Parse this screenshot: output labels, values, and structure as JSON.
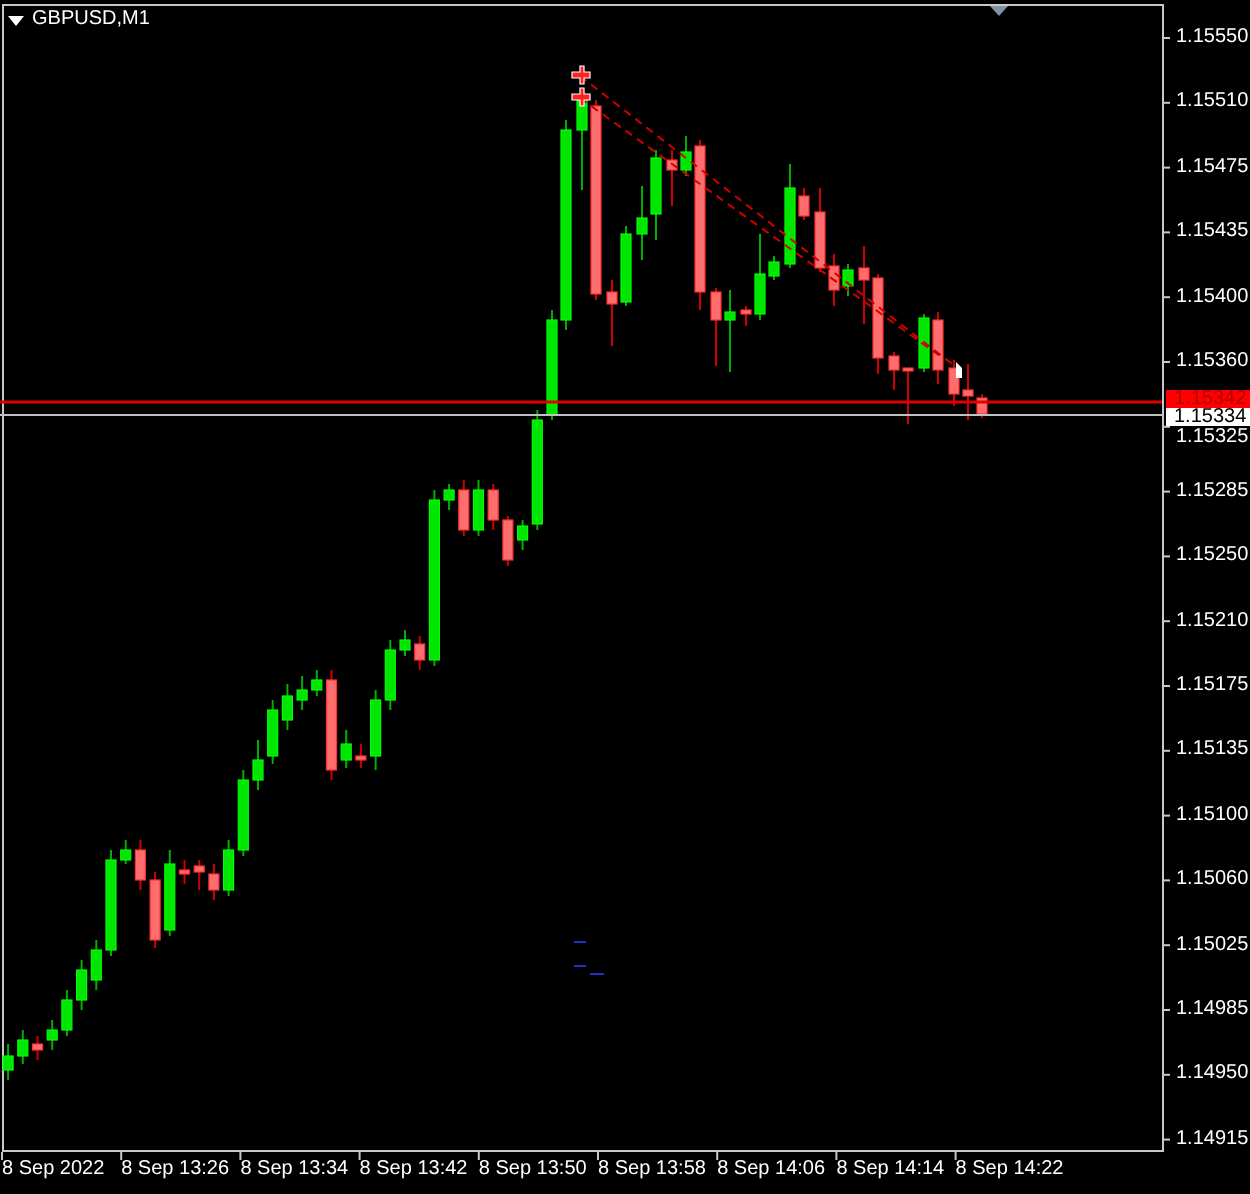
{
  "chart": {
    "title": "GBPUSD,M1",
    "price_axis": [
      "1.15550",
      "1.15510",
      "1.15475",
      "1.15435",
      "1.15400",
      "1.15360",
      "1.15325",
      "1.15285",
      "1.15250",
      "1.15210",
      "1.15175",
      "1.15135",
      "1.15100",
      "1.15060",
      "1.15025",
      "1.14985",
      "1.14950",
      "1.14915"
    ],
    "time_axis": [
      "8 Sep 2022",
      "8 Sep 13:26",
      "8 Sep 13:34",
      "8 Sep 13:42",
      "8 Sep 13:50",
      "8 Sep 13:58",
      "8 Sep 14:06",
      "8 Sep 14:14",
      "8 Sep 14:22"
    ],
    "bid_label": "1.15342",
    "last_label": "1.15334"
  }
}
